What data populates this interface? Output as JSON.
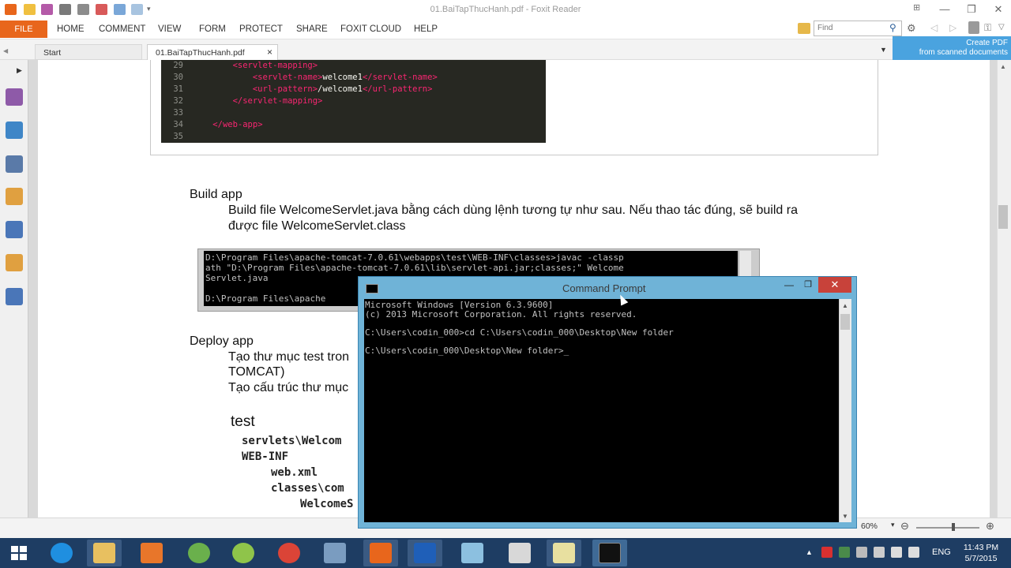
{
  "window": {
    "title": "01.BaiTapThucHanh.pdf - Foxit Reader",
    "minimize": "—",
    "restore": "❐",
    "close": "✕"
  },
  "ribbon": {
    "file_tab": "FILE",
    "tabs": [
      "HOME",
      "COMMENT",
      "VIEW",
      "FORM",
      "PROTECT",
      "SHARE",
      "FOXIT CLOUD",
      "HELP"
    ],
    "find_placeholder": "Find"
  },
  "doc_tabs": {
    "start": "Start",
    "active": "01.BaiTapThucHanh.pdf",
    "close": "×"
  },
  "promo": {
    "line1": "Create PDF",
    "line2": "from scanned documents"
  },
  "code_listing": [
    {
      "ln": "29",
      "indent": "        ",
      "parts": [
        [
          "tag",
          "<servlet-mapping>"
        ]
      ]
    },
    {
      "ln": "30",
      "indent": "            ",
      "parts": [
        [
          "tag",
          "<servlet-name>"
        ],
        [
          "wt",
          "welcome1"
        ],
        [
          "tag",
          "</servlet-name>"
        ]
      ]
    },
    {
      "ln": "31",
      "indent": "            ",
      "parts": [
        [
          "tag",
          "<url-pattern>"
        ],
        [
          "wt",
          "/welcome1"
        ],
        [
          "tag",
          "</url-pattern>"
        ]
      ]
    },
    {
      "ln": "32",
      "indent": "        ",
      "parts": [
        [
          "tag",
          "</servlet-mapping>"
        ]
      ]
    },
    {
      "ln": "33",
      "indent": "",
      "parts": []
    },
    {
      "ln": "34",
      "indent": "    ",
      "parts": [
        [
          "tag",
          "</web-app>"
        ]
      ]
    },
    {
      "ln": "35",
      "indent": "",
      "parts": []
    }
  ],
  "document": {
    "build_heading": "Build app",
    "build_line1": "Build file WelcomeServlet.java bằng cách dùng lệnh tương tự như sau. Nếu thao tác đúng, sẽ build ra",
    "build_line2": "được file WelcomeServlet.class",
    "javac_text": "D:\\Program Files\\apache-tomcat-7.0.61\\webapps\\test\\WEB-INF\\classes>javac -classp\nath \"D:\\Program Files\\apache-tomcat-7.0.61\\lib\\servlet-api.jar;classes;\" Welcome\nServlet.java\n\nD:\\Program Files\\apache",
    "deploy_heading": "Deploy app",
    "deploy_line1": "Tạo thư mục test tron",
    "deploy_line2": "TOMCAT)",
    "deploy_line3": "Tạo cấu trúc thư mục",
    "tree_root": "test",
    "tree": [
      "servlets\\Welcom",
      "WEB-INF",
      "web.xml",
      "classes\\com",
      "WelcomeS"
    ]
  },
  "status_bar": {
    "zoom": "60%"
  },
  "cmd": {
    "title": "Command Prompt",
    "console": "Microsoft Windows [Version 6.3.9600]\n(c) 2013 Microsoft Corporation. All rights reserved.\n\nC:\\Users\\codin_000>cd C:\\Users\\codin_000\\Desktop\\New folder\n\nC:\\Users\\codin_000\\Desktop\\New folder>_"
  },
  "taskbar": {
    "lang": "ENG",
    "time": "11:43 PM",
    "date": "5/7/2015"
  },
  "colors": {
    "foxit_orange": "#e8661c",
    "taskbar_blue": "#1e3d63",
    "cmd_title_blue": "#6fb3d7",
    "close_red": "#c8423a"
  }
}
